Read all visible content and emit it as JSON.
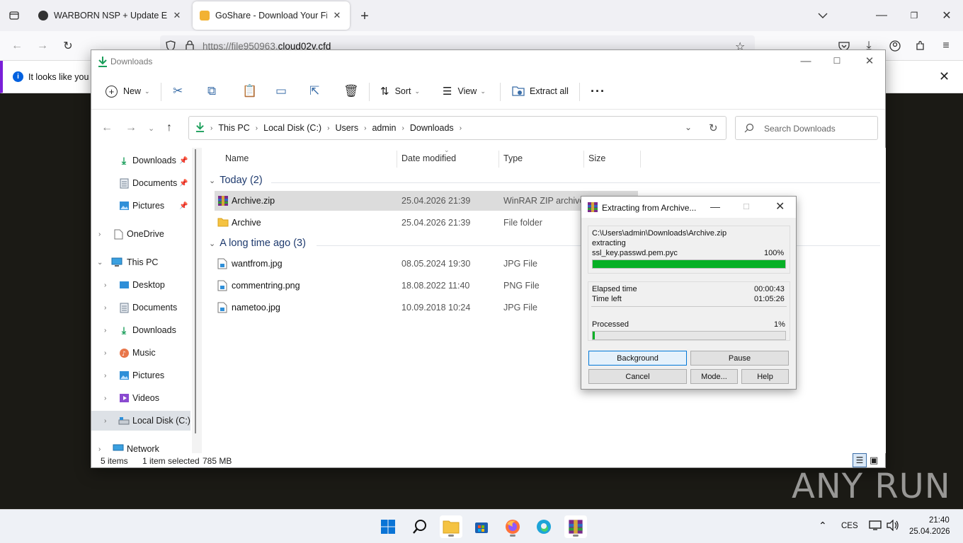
{
  "browser": {
    "tabs": [
      {
        "title": "WARBORN NSP + Update Epic N",
        "active": false
      },
      {
        "title": "GoShare - Download Your File",
        "active": true
      }
    ],
    "url_prefix": "https://file950963.",
    "url_domain": "cloud02v.cfd",
    "notification": "It looks like you h"
  },
  "explorer": {
    "title": "Downloads",
    "toolbar": {
      "new": "New",
      "sort": "Sort",
      "view": "View",
      "extract_all": "Extract all"
    },
    "breadcrumb": [
      "This PC",
      "Local Disk (C:)",
      "Users",
      "admin",
      "Downloads"
    ],
    "search_placeholder": "Search Downloads",
    "nav": {
      "quick": [
        {
          "label": "Downloads"
        },
        {
          "label": "Documents"
        },
        {
          "label": "Pictures"
        }
      ],
      "onedrive": "OneDrive",
      "thispc": "This PC",
      "pc_items": [
        "Desktop",
        "Documents",
        "Downloads",
        "Music",
        "Pictures",
        "Videos",
        "Local Disk (C:)"
      ],
      "network": "Network"
    },
    "columns": {
      "name": "Name",
      "date": "Date modified",
      "type": "Type",
      "size": "Size"
    },
    "groups": [
      {
        "header": "Today (2)",
        "files": [
          {
            "name": "Archive.zip",
            "date": "25.04.2026 21:39",
            "type": "WinRAR ZIP archive",
            "icon": "winrar-icon"
          },
          {
            "name": "Archive",
            "date": "25.04.2026 21:39",
            "type": "File folder",
            "icon": "folder-icon"
          }
        ]
      },
      {
        "header": "A long time ago (3)",
        "files": [
          {
            "name": "wantfrom.jpg",
            "date": "08.05.2024 19:30",
            "type": "JPG File",
            "icon": "image-file-icon"
          },
          {
            "name": "commentring.png",
            "date": "18.08.2022 11:40",
            "type": "PNG File",
            "icon": "image-file-icon"
          },
          {
            "name": "nametoo.jpg",
            "date": "10.09.2018 10:24",
            "type": "JPG File",
            "icon": "image-file-icon"
          }
        ]
      }
    ],
    "status": {
      "count": "5 items",
      "selected": "1 item selected",
      "size": "785 MB"
    }
  },
  "rar_dialog": {
    "title": "Extracting from Archive...",
    "archive_path": "C:\\Users\\admin\\Downloads\\Archive.zip",
    "action": "extracting",
    "current_file": "ssl_key.passwd.pem.pyc",
    "file_percent": "100%",
    "file_progress": 1.0,
    "elapsed_label": "Elapsed time",
    "elapsed_value": "00:00:43",
    "left_label": "Time left",
    "left_value": "01:05:26",
    "processed_label": "Processed",
    "processed_percent": "1%",
    "processed_progress": 0.01,
    "buttons": {
      "background": "Background",
      "pause": "Pause",
      "cancel": "Cancel",
      "mode": "Mode...",
      "help": "Help"
    }
  },
  "watermark": "ANY RUN",
  "taskbar": {
    "language": "CES",
    "time": "21:40",
    "date": "25.04.2026"
  },
  "colors": {
    "accent": "#0078d7",
    "progress": "#06b025",
    "firefox_purple": "#7a1fd8"
  }
}
